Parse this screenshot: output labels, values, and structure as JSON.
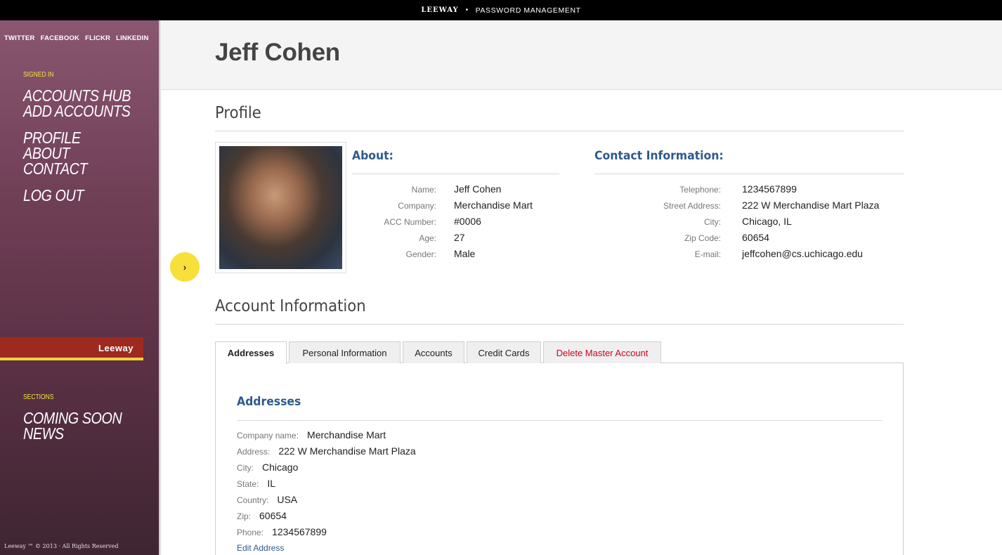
{
  "topbar": {
    "brand": "LEEWAY",
    "separator": "•",
    "subtitle": "PASSWORD MANAGEMENT"
  },
  "sidebar": {
    "social": [
      "TWITTER",
      "FACEBOOK",
      "FLICKR",
      "LINKEDIN"
    ],
    "signed_in_label": "SIGNED IN",
    "nav_group_1": [
      "ACCOUNTS HUB",
      "ADD ACCOUNTS"
    ],
    "nav_group_2": [
      "PROFILE",
      "ABOUT",
      "CONTACT"
    ],
    "nav_group_3": [
      "LOG OUT"
    ],
    "brand_tab": "Leeway",
    "sections_label": "SECTIONS",
    "sections": [
      "COMING SOON",
      "NEWS"
    ],
    "copyright": "Leeway ™ © 2013 · All Rights Reserved"
  },
  "toggle": {
    "icon": "chevron-right-icon",
    "glyph": "›"
  },
  "header": {
    "name": "Jeff Cohen"
  },
  "profile": {
    "title": "Profile",
    "about_title": "About:",
    "about": [
      {
        "key": "Name:",
        "value": "Jeff Cohen"
      },
      {
        "key": "Company:",
        "value": "Merchandise Mart"
      },
      {
        "key": "ACC Number:",
        "value": "#0006"
      },
      {
        "key": "Age:",
        "value": "27"
      },
      {
        "key": "Gender:",
        "value": "Male"
      }
    ],
    "contact_title": "Contact Information:",
    "contact": [
      {
        "key": "Telephone:",
        "value": "1234567899"
      },
      {
        "key": "Street Address:",
        "value": "222 W Merchandise Mart Plaza"
      },
      {
        "key": "City:",
        "value": "Chicago, IL"
      },
      {
        "key": "Zip Code:",
        "value": "60654"
      },
      {
        "key": "E-mail:",
        "value": "jeffcohen@cs.uchicago.edu"
      }
    ]
  },
  "account": {
    "title": "Account Information",
    "tabs": [
      "Addresses",
      "Personal Information",
      "Accounts",
      "Credit Cards",
      "Delete Master Account"
    ],
    "panel_title": "Addresses",
    "addresses": [
      {
        "key": "Company name:",
        "value": "Merchandise Mart"
      },
      {
        "key": "Address:",
        "value": "222 W Merchandise Mart Plaza"
      },
      {
        "key": "City:",
        "value": "Chicago"
      },
      {
        "key": "State:",
        "value": "IL"
      },
      {
        "key": "Country:",
        "value": "USA"
      },
      {
        "key": "Zip:",
        "value": "60654"
      },
      {
        "key": "Phone:",
        "value": "1234567899"
      }
    ],
    "edit_link": "Edit Address"
  },
  "colors": {
    "accent_blue": "#2f5a8d",
    "danger": "#d0021b",
    "yellow": "#f7e03a",
    "sidebar": "#6e3e55",
    "brand_tab": "#9e2a1f"
  }
}
